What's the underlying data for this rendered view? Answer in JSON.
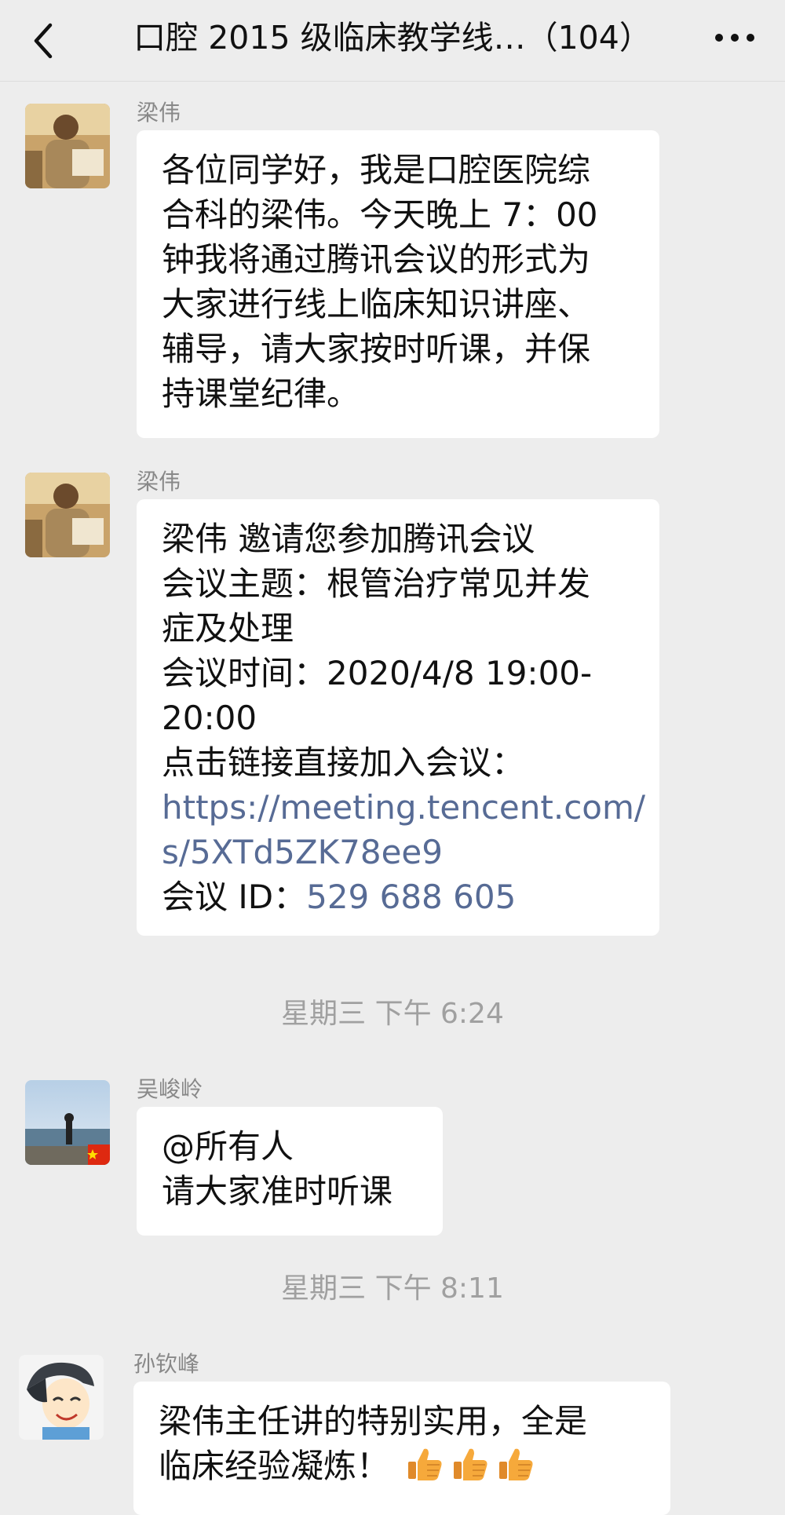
{
  "header": {
    "title": "口腔 2015 级临床教学线…（104）",
    "back_icon": "chevron-left-icon",
    "more_icon": "more-dots-icon"
  },
  "messages": [
    {
      "sender": "梁伟",
      "lines": [
        "各位同学好，我是口腔医院综",
        "合科的梁伟。今天晚上 7：00",
        "钟我将通过腾讯会议的形式为",
        "大家进行线上临床知识讲座、",
        "辅导，请大家按时听课，并保",
        "持课堂纪律。"
      ]
    },
    {
      "sender": "梁伟",
      "lines": [
        "梁伟 邀请您参加腾讯会议",
        "会议主题：根管治疗常见并发",
        "症及处理",
        "会议时间：2020/4/8 19:00-",
        "20:00",
        "点击链接直接加入会议："
      ],
      "link_lines": [
        "https://meeting.tencent.com/",
        "s/5XTd5ZK78ee9"
      ],
      "id_label": "会议 ID：",
      "id_value": "529 688 605"
    },
    {
      "sender": "吴峻岭",
      "lines": [
        "@所有人",
        "请大家准时听课"
      ]
    },
    {
      "sender": "孙钦峰",
      "lines": [
        "梁伟主任讲的特别实用，全是",
        "临床经验凝炼！"
      ],
      "emoji": "thumbs-up-icon"
    }
  ],
  "timestamps": [
    "星期三 下午 6:24",
    "星期三 下午 8:11"
  ],
  "colors": {
    "background": "#ededed",
    "bubble": "#ffffff",
    "link": "#576b95",
    "timestamp": "#a0a0a0"
  }
}
